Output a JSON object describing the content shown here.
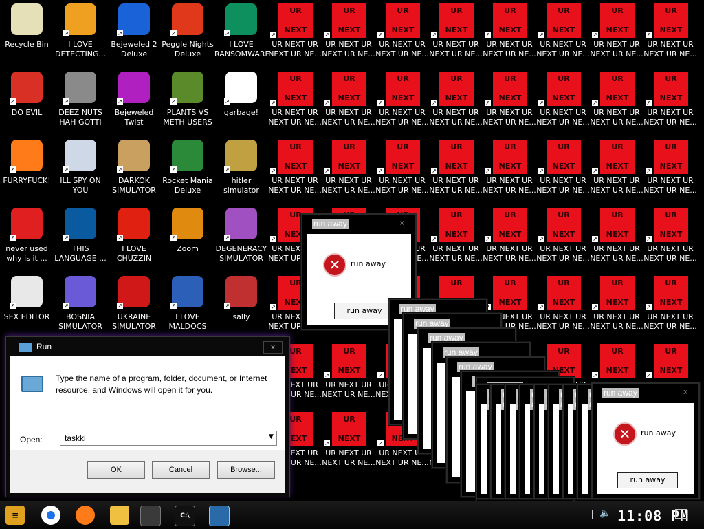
{
  "desktop": {
    "icons": [
      {
        "label": "Recycle Bin",
        "name": "recycle-bin-icon",
        "color": "#e5e0b8"
      },
      {
        "label": "I LOVE\nDETECTING...",
        "name": "detecting-icon",
        "color": "#f0a020"
      },
      {
        "label": "Bejeweled 2\nDeluxe",
        "name": "bejeweled-2-icon",
        "color": "#1a62d8"
      },
      {
        "label": "Peggle Nights\nDeluxe",
        "name": "peggle-icon",
        "color": "#e0381a"
      },
      {
        "label": "I LOVE\nRANSOMWARE",
        "name": "ransomware-icon",
        "color": "#0d8f5e"
      },
      {
        "label": "DO EVIL",
        "name": "chrome-icon",
        "color": "#d93025"
      },
      {
        "label": "DEEZ NUTS\nHAH GOTTI",
        "name": "copy-icon",
        "color": "#8a8a8a"
      },
      {
        "label": "Bejeweled\nTwist",
        "name": "bejeweled-twist-icon",
        "color": "#b01fc0"
      },
      {
        "label": "PLANTS VS\nMETH USERS",
        "name": "plants-icon",
        "color": "#5a8a2a"
      },
      {
        "label": "garbage!",
        "name": "garbage-icon",
        "color": "#ffffff"
      },
      {
        "label": "FURRYFUCK!",
        "name": "firefox-icon",
        "color": "#ff7a18"
      },
      {
        "label": "ILL SPY ON\nYOU",
        "name": "spy-icon",
        "color": "#cfd8e6"
      },
      {
        "label": "DARKOK\nSIMULATOR",
        "name": "money-bag-icon",
        "color": "#caa060"
      },
      {
        "label": "Rocket Mania\nDeluxe",
        "name": "rocket-icon",
        "color": "#2a8a3a"
      },
      {
        "label": "hitler simulator",
        "name": "coin-icon",
        "color": "#c0a040"
      },
      {
        "label": "never used\nwhy is it ...",
        "name": "devcpp-icon",
        "color": "#e02020"
      },
      {
        "label": "THIS\nLANGUAGE ...",
        "name": "golang-icon",
        "color": "#0a5aa0"
      },
      {
        "label": "I LOVE\nCHUZZIN",
        "name": "chuzzle-icon",
        "color": "#e02010"
      },
      {
        "label": "Zoom",
        "name": "zoom-icon",
        "color": "#e08a10"
      },
      {
        "label": "DEGENERACY\nSIMULATOR",
        "name": "degeneracy-icon",
        "color": "#a050c0"
      },
      {
        "label": "SEX EDITOR",
        "name": "hxd-icon",
        "color": "#e8e8e8"
      },
      {
        "label": "BOSNIA\nSIMULATOR",
        "name": "mine-icon",
        "color": "#6a5ad8"
      },
      {
        "label": "UKRAINE\nSIMULATOR",
        "name": "radiation-icon",
        "color": "#d01818"
      },
      {
        "label": "I LOVE\nMALDOCS",
        "name": "word-icon",
        "color": "#2b5fb8"
      },
      {
        "label": "sally",
        "name": "sally-icon",
        "color": "#c03030"
      }
    ],
    "ur_top": "UR",
    "ur_bottom": "NEXT",
    "ur_label": "UR NEXT UR\nNEXT UR NE..."
  },
  "popup": {
    "title": "run away",
    "message": "run away",
    "button": "run away",
    "close": "x"
  },
  "run_dialog": {
    "title": "Run",
    "description": "Type the name of a program, folder, document, or Internet resource, and Windows will open it for you.",
    "open_label": "Open:",
    "open_value": "taskki",
    "ok": "OK",
    "cancel": "Cancel",
    "browse": "Browse...",
    "close": "x"
  },
  "taskbar": {
    "clock": "11:08 PM"
  }
}
